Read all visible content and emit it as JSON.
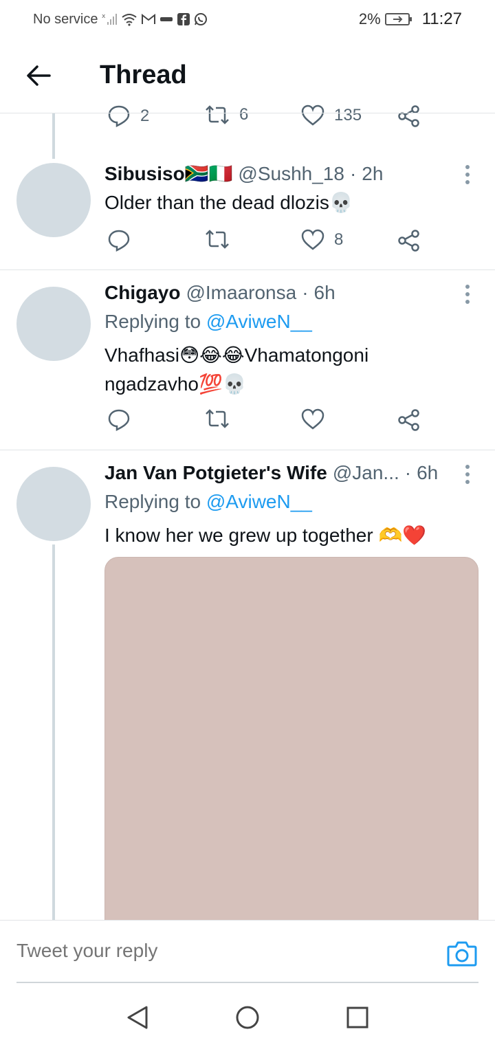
{
  "status_bar": {
    "carrier": "No service",
    "battery": "2%",
    "time": "11:27"
  },
  "header": {
    "title": "Thread"
  },
  "partial_tweet": {
    "reply_count": "2",
    "retweet_count": "6",
    "like_count": "135"
  },
  "tweets": [
    {
      "name": "Sibusiso🇿🇦🇮🇹",
      "handle": "@Sushh_18",
      "time": "2h",
      "text": "Older than the dead dlozis💀",
      "reply_count": "",
      "retweet_count": "",
      "like_count": "8"
    },
    {
      "name": "Chigayo",
      "handle": "@Imaaronsa",
      "time": "6h",
      "replying_prefix": "Replying to",
      "replying_to": "@AviweN__",
      "text": "Vhafhasi😳😂😂Vhamatongoni ngadzavho💯💀"
    },
    {
      "name": "Jan Van Potgieter's Wife",
      "handle": "@Jan...",
      "time": "6h",
      "replying_prefix": "Replying to",
      "replying_to": "@AviweN__",
      "text": "I know her we grew up together 🫶❤️"
    }
  ],
  "reply_bar": {
    "placeholder": "Tweet your reply"
  },
  "colors": {
    "accent": "#1d9bf0",
    "text_secondary": "#536471",
    "avatar_placeholder": "#d3dce2",
    "media_placeholder": "#d6c1bb"
  }
}
